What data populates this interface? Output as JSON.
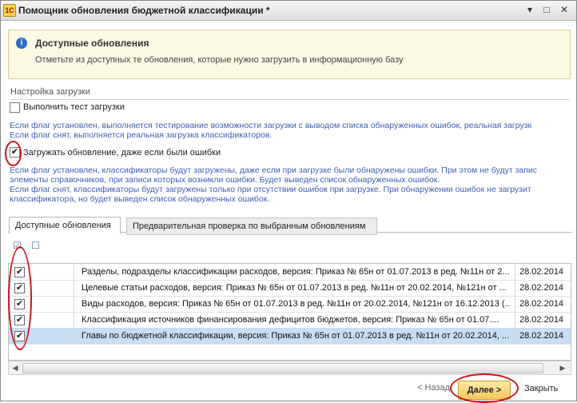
{
  "window": {
    "title": "Помощник обновления бюджетной классификации *",
    "app_icon_glyph": "1С",
    "controls": {
      "menu": "▾",
      "minimize": "–",
      "maximize": "□",
      "close": "✕"
    }
  },
  "info": {
    "icon": "info-icon",
    "title": "Доступные обновления",
    "text": "Отметьте из доступных те обновления, которые нужно загрузить в информационную базу"
  },
  "settings": {
    "group_title": "Настройка загрузки",
    "test_load": {
      "label": "Выполнить тест загрузки",
      "checked": false,
      "hint": "Если флаг установлен, выполняется тестирование возможности загрузки с выводом списка обнаруженных ошибок, реальная загрузк\nЕсли флаг снят, выполняется реальная загрузка классификаторов."
    },
    "load_with_errors": {
      "label": "Загружать обновление, даже если были ошибки",
      "checked": true,
      "hint": "Если флаг установлен, классификаторы будут загружены, даже если при загрузке были обнаружены ошибки. При этом не будут запис\nэлементы справочников, при записи которых возникли ошибки. Будет выведен список обнаруженных ошибок.\nЕсли флаг снят, классификаторы будут загружены только при отсутствии ошибок при загрузке. При обнаружении ошибок не загрузит\nклассификатора, но будет выведен список обнаруженных ошибок."
    }
  },
  "tabs": [
    {
      "label": "Доступные обновления",
      "active": true
    },
    {
      "label": "Предварительная проверка по выбранным обновлениям",
      "active": false
    }
  ],
  "toolbar": {
    "icons": [
      "check-all-icon",
      "uncheck-all-icon"
    ]
  },
  "grid": {
    "rows": [
      {
        "checked": true,
        "name": "Разделы, подразделы классификации расходов, версия: Приказ № 65н от 01.07.2013 в ред. №11н от 2...",
        "date": "28.02.2014",
        "selected": false
      },
      {
        "checked": true,
        "name": "Целевые статьи расходов, версия: Приказ № 65н от 01.07.2013 в ред. №11н от 20.02.2014, №121н от ...",
        "date": "28.02.2014",
        "selected": false
      },
      {
        "checked": true,
        "name": "Виды расходов, версия: Приказ № 65н от 01.07.2013 в ред. №11н от 20.02.2014, №121н от 16.12.2013 (...",
        "date": "28.02.2014",
        "selected": false
      },
      {
        "checked": true,
        "name": "Классификация источников финансирования дефицитов бюджетов, версия: Приказ № 65н от 01.07....",
        "date": "28.02.2014",
        "selected": false
      },
      {
        "checked": true,
        "name": "Главы по бюджетной классификации, версия: Приказ № 65н от 01.07.2013 в ред. №11н от 20.02.2014, ...",
        "date": "28.02.2014",
        "selected": true
      }
    ]
  },
  "footer": {
    "back_label": "< Назад",
    "next_label": "Далее >",
    "close_label": "Закрыть"
  },
  "colors": {
    "hint_text": "#3d5fb5",
    "annotation_red": "#d0161a",
    "selected_row": "#c9ddf3",
    "next_button": "#f3c95c",
    "info_panel": "#fbf8e4"
  }
}
